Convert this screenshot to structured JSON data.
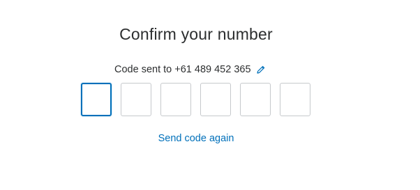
{
  "title": "Confirm your number",
  "code_sent": {
    "label": "Code sent to +61 489 452 365",
    "edit_icon": "pencil-icon"
  },
  "code_inputs": [
    {
      "value": "",
      "active": true
    },
    {
      "value": "",
      "active": false
    },
    {
      "value": "",
      "active": false
    },
    {
      "value": "",
      "active": false
    },
    {
      "value": "",
      "active": false
    },
    {
      "value": "",
      "active": false
    }
  ],
  "resend_link": "Send code again",
  "colors": {
    "accent": "#0070ba",
    "text": "#2c2e2f",
    "box_border": "#c6c9cc"
  }
}
